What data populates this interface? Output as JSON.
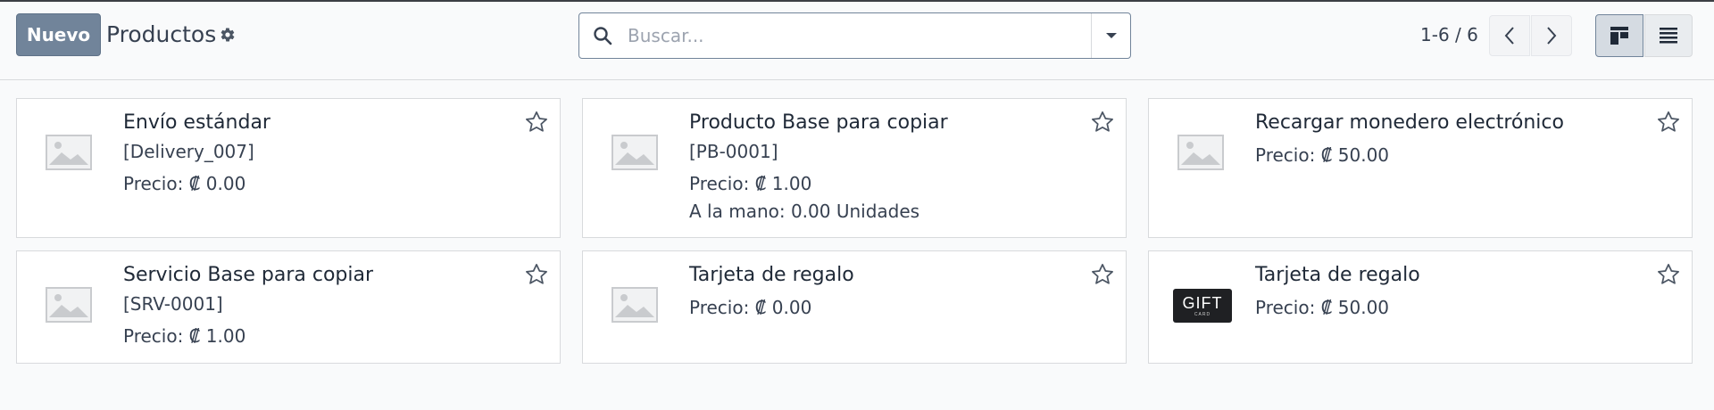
{
  "toolbar": {
    "new_label": "Nuevo",
    "title": "Productos"
  },
  "search": {
    "placeholder": "Buscar..."
  },
  "pager": {
    "value": "1-6 / 6"
  },
  "products": [
    {
      "name": "Envío estándar",
      "ref": "[Delivery_007]",
      "price": "Precio: ₡ 0.00",
      "stock": "",
      "image": "placeholder"
    },
    {
      "name": "Producto Base para copiar",
      "ref": "[PB-0001]",
      "price": "Precio: ₡ 1.00",
      "stock": "A la mano: 0.00 Unidades",
      "image": "placeholder"
    },
    {
      "name": "Recargar monedero electrónico",
      "ref": "",
      "price": "Precio: ₡ 50.00",
      "stock": "",
      "image": "placeholder"
    },
    {
      "name": "Servicio Base para copiar",
      "ref": "[SRV-0001]",
      "price": "Precio: ₡ 1.00",
      "stock": "",
      "image": "placeholder"
    },
    {
      "name": "Tarjeta de regalo",
      "ref": "",
      "price": "Precio: ₡ 0.00",
      "stock": "",
      "image": "placeholder"
    },
    {
      "name": "Tarjeta de regalo",
      "ref": "",
      "price": "Precio: ₡ 50.00",
      "stock": "",
      "image": "gift-card"
    }
  ],
  "gift_card_image": {
    "text": "GIFT",
    "subtext": "CARD"
  },
  "colors": {
    "primary": "#71849a",
    "border": "#d8dadd",
    "background": "#f9fafb"
  }
}
